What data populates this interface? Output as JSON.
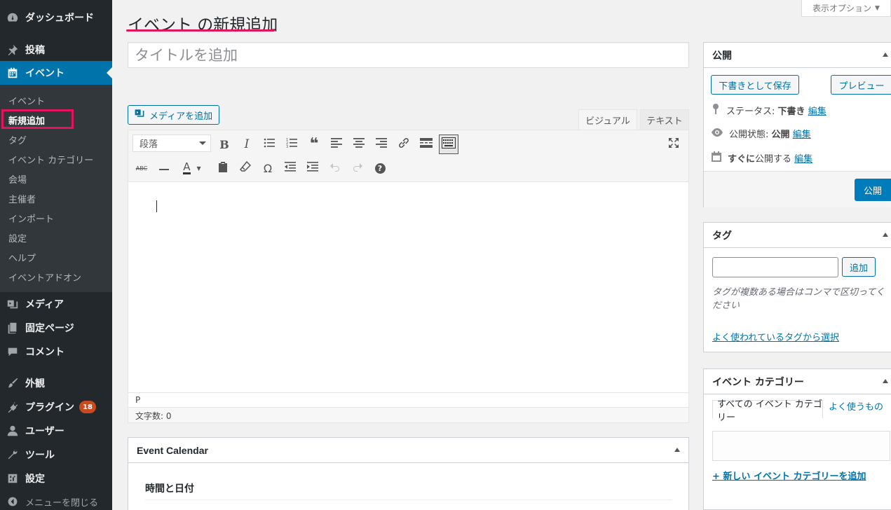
{
  "sidebar": {
    "menu": [
      {
        "label": "ダッシュボード",
        "icon": "dashboard-icon"
      },
      {
        "label": "投稿",
        "icon": "pin-icon"
      },
      {
        "label": "イベント",
        "icon": "calendar-icon"
      },
      {
        "label": "メディア",
        "icon": "media-icon"
      },
      {
        "label": "固定ページ",
        "icon": "page-icon"
      },
      {
        "label": "コメント",
        "icon": "comment-icon"
      },
      {
        "label": "外観",
        "icon": "brush-icon"
      },
      {
        "label": "プラグイン",
        "icon": "plugin-icon",
        "badge": "18"
      },
      {
        "label": "ユーザー",
        "icon": "user-icon"
      },
      {
        "label": "ツール",
        "icon": "wrench-icon"
      },
      {
        "label": "設定",
        "icon": "settings-icon"
      }
    ],
    "submenu": [
      "イベント",
      "新規追加",
      "タグ",
      "イベント カテゴリー",
      "会場",
      "主催者",
      "インポート",
      "設定",
      "ヘルプ",
      "イベントアドオン"
    ],
    "collapse_label": "メニューを閉じる",
    "highlight_color": "#e4145c",
    "current_color": "#0073aa"
  },
  "header": {
    "page_title": "イベント の新規追加",
    "screen_options": "表示オプション"
  },
  "title_field": {
    "placeholder": "タイトルを追加"
  },
  "editor": {
    "add_media": "メディアを追加",
    "tab_visual": "ビジュアル",
    "tab_text": "テキスト",
    "format_select": "段落",
    "path": "P",
    "word_count": "文字数: 0",
    "toolbar_row1": [
      "bold-icon",
      "italic-icon",
      "bullet-list-icon",
      "numbered-list-icon",
      "blockquote-icon",
      "align-left-icon",
      "align-center-icon",
      "align-right-icon",
      "link-icon",
      "read-more-icon",
      "toolbar-toggle-icon"
    ],
    "toolbar_row2": [
      "strikethrough-icon",
      "horizontal-line-icon",
      "text-color-icon",
      "paste-text-icon",
      "clear-formatting-icon",
      "special-char-icon",
      "outdent-icon",
      "indent-icon",
      "undo-icon",
      "redo-icon",
      "help-icon"
    ]
  },
  "event_calendar": {
    "title": "Event Calendar",
    "section": "時間と日付"
  },
  "publish": {
    "title": "公開",
    "save_draft": "下書きとして保存",
    "preview": "プレビュー",
    "status_label": "ステータス:",
    "status_value": "下書き",
    "visibility_label": "公開状態:",
    "visibility_value": "公開",
    "schedule_bold": "すぐに",
    "schedule_rest": "公開する",
    "edit": "編集",
    "publish_button": "公開"
  },
  "tags": {
    "title": "タグ",
    "add_button": "追加",
    "help": "タグが複数ある場合はコンマで区切ってください",
    "choose_link": "よく使われているタグから選択"
  },
  "categories": {
    "title": "イベント カテゴリー",
    "tab_all": "すべての イベント カテゴリー",
    "tab_popular": "よく使うもの",
    "add_new": "+ 新しい イベント カテゴリーを追加"
  }
}
